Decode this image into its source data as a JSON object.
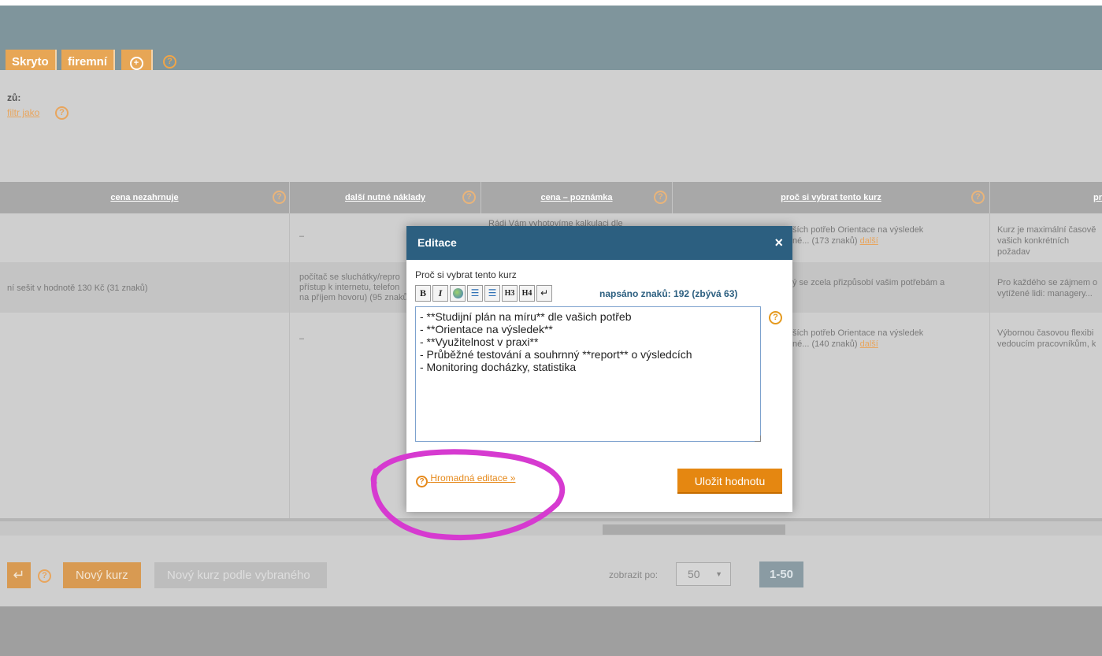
{
  "tabs": [
    {
      "label": "Skryto"
    },
    {
      "label": "firemní"
    }
  ],
  "filter": {
    "title": "zů:",
    "link": "filtr jako"
  },
  "table": {
    "headers": [
      "cena nezahrnuje",
      "další nutné náklady",
      "cena – poznámka",
      "proč si vybrat tento kurz",
      "pr"
    ],
    "rows": [
      {
        "c1": "",
        "c2": "–",
        "c3": "Rádi Vám vyhotovíme kalkulaci dle",
        "c4a": "ších potřeb Orientace na výsledek",
        "c4b": "né... (173 znaků)",
        "c4link": "další",
        "c5a": "Kurz je maximální časově",
        "c5b": "vašich konkrétních požadav"
      },
      {
        "c1": "ní sešit v hodnotě 130 Kč (31 znaků)",
        "c2a": "počítač se sluchátky/repro",
        "c2b": "přístup k internetu, telefon",
        "c2c": "na příjem hovoru) (95 znaků)",
        "c4a": "ý se zcela přizpůsobí vašim potřebám a",
        "c5a": "Pro každého se zájmem o",
        "c5b": "vytížené lidi: managery..."
      },
      {
        "c1": "",
        "c2": "–",
        "c4a": "ších potřeb Orientace na výsledek",
        "c4b": "né... (140 znaků)",
        "c4link": "další",
        "c5a": "Výbornou časovou flexibi",
        "c5b": "vedoucím pracovníkům, k"
      }
    ]
  },
  "footer": {
    "new_course": "Nový kurz",
    "new_course_from": "Nový kurz podle vybraného",
    "show_per": "zobrazit po:",
    "per_page": "50",
    "range": "1-50"
  },
  "modal": {
    "title": "Editace",
    "close": "×",
    "field_label": "Proč si vybrat tento kurz",
    "char_count": "napsáno znaků: 192 (zbývá 63)",
    "toolbar": [
      "B",
      "I",
      "H3",
      "H4"
    ],
    "text": "- **Studijní plán na míru** dle vašich potřeb\n- **Orientace na výsledek**\n- **Využitelnost v praxi**\n- Průběžné testování a souhrnný **report** o výsledcích\n- Monitoring docházky, statistika",
    "bulk_edit": "Hromadná editace »",
    "save": "Uložit hodnotu"
  },
  "colors": {
    "accent": "#e58711",
    "modal_header": "#2c5f80",
    "annotation": "#d63ad0"
  }
}
